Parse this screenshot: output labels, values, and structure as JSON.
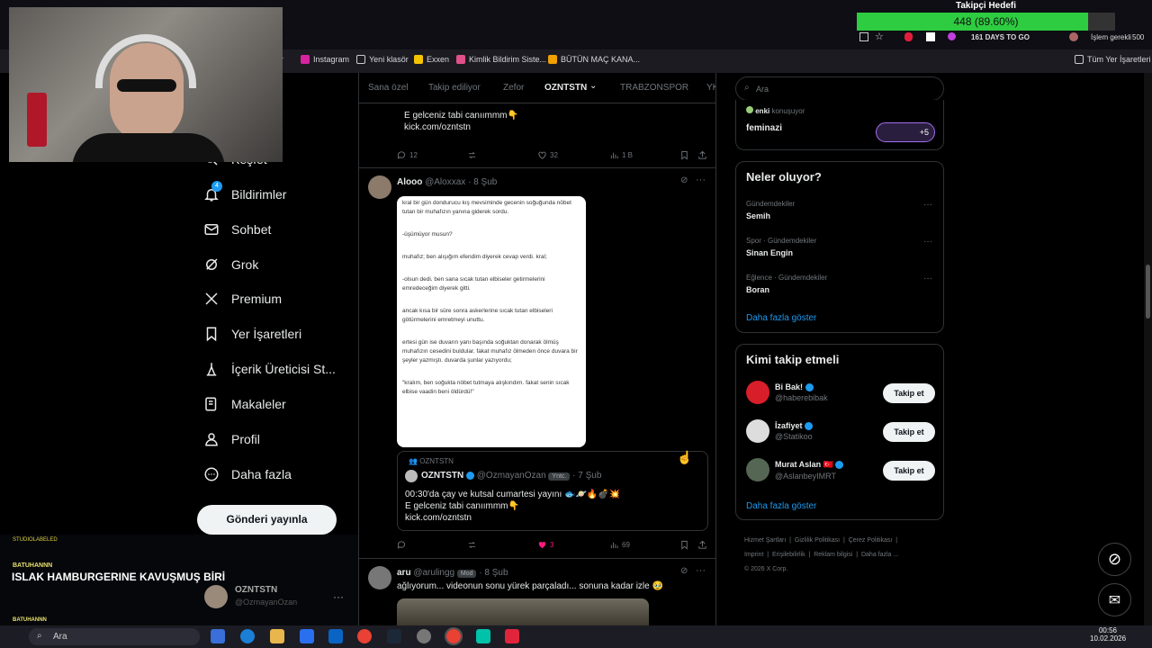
{
  "browser": {
    "bookmarks": [
      "r",
      "Instagram",
      "Yeni klasör",
      "Exxen",
      "Kimlik Bildirim Siste...",
      "BÜTÜN MAÇ KANA..."
    ],
    "all_bookmarks": "Tüm Yer İşaretleri",
    "toolbar_text": "161 DAYS TO GO",
    "toolbar_text2": "İşlem gerekli",
    "toolbar_num": "500"
  },
  "overlay": {
    "follower_goal_title": "Takipçi Hedefi",
    "follower_goal_value": "448 (89.60%)",
    "follower_goal_fraction": 0.896,
    "chat_username_small": "BATUHANNN",
    "chat_message": "ISLAK HAMBURGERINE KAVUŞMUŞ BİRİ",
    "chat_username_small2": "BATUHANNN",
    "streamer_name": "OZNTSTN",
    "streamer_handle": "@OzmayanOzan",
    "faint_label": "STUDIOLABELED"
  },
  "nav": {
    "items": [
      {
        "label": "Keşfet",
        "icon": "search-icon"
      },
      {
        "label": "Bildirimler",
        "icon": "bell-icon",
        "badge": "4"
      },
      {
        "label": "Sohbet",
        "icon": "mail-icon"
      },
      {
        "label": "Grok",
        "icon": "grok-icon"
      },
      {
        "label": "Premium",
        "icon": "x-logo-icon"
      },
      {
        "label": "Yer İşaretleri",
        "icon": "bookmark-icon"
      },
      {
        "label": "İçerik Üreticisi St...",
        "icon": "creator-studio-icon"
      },
      {
        "label": "Makaleler",
        "icon": "article-icon"
      },
      {
        "label": "Profil",
        "icon": "profile-icon"
      },
      {
        "label": "Daha fazla",
        "icon": "more-circle-icon"
      }
    ],
    "post_button": "Gönderi yayınla"
  },
  "feed": {
    "tabs": [
      "Sana özel",
      "Takip ediliyor",
      "Zefor",
      "OZNTSTN",
      "TRABZONSPOR",
      "YK"
    ],
    "active_tab": "OZNTSTN",
    "top_tweet": {
      "line1": "E gelceniz tabi canıımmm👇",
      "line2": "kick.com/ozntstn",
      "replies": "12",
      "likes": "32",
      "views": "1 B"
    },
    "tweet2": {
      "name": "Alooo",
      "handle": "@Aloxxax",
      "date": "8 Şub",
      "image_text": [
        "kral bir gün dondurucu kış mevsiminde gecenin soğuğunda nöbet tutan bir muhafızın yanına giderek sordu.",
        "-üşümüyor musun?",
        "muhafız; ben alışığım efendim diyerek cevap verdi. kral;",
        "-olsun dedi. ben sana sıcak tutan elbiseler getirmelerini emredeceğim diyerek gitti.",
        "ancak kısa bir süre sonra askerlerine sıcak tutan elbiseleri götürmelerini emretmeyi unuttu.",
        "ertesi gün ise duvarın yanı başında soğuktan donarak ölmüş muhafızın cesedini buldular. fakat muhafız ölmeden önce duvara bir şeyler yazmıştı. duvarda şunlar yazıyordu;",
        "\"kralım, ben soğukta nöbet tutmaya alışkındım. fakat senin sıcak elbise vaadin beni öldürdü!\""
      ],
      "quote_community": "OZNTSTN",
      "quote_name": "OZNTSTN",
      "quote_handle": "@OzmayanOzan",
      "quote_badge": "Yntc.",
      "quote_date": "7 Şub",
      "quote_line1": "00:30'da çay ve kutsal cumartesi yayını 🐟🪐🔥💣💥",
      "quote_line2": "E gelceniz tabi canıımmm👇",
      "quote_line3": "kick.com/ozntstn",
      "likes": "3",
      "views": "69"
    },
    "tweet3": {
      "name": "aru",
      "handle": "@arulingg",
      "badge": "Mod",
      "date": "8 Şub",
      "text": "ağlıyorum... videonun sonu yürek parçaladı... sonuna kadar izle 🥹"
    }
  },
  "right": {
    "search_placeholder": "Ara",
    "space_host": "enki",
    "space_host_suffix": "konuşuyor",
    "space_title": "feminazi",
    "space_more": "+5",
    "trends_title": "Neler oluyor?",
    "trends": [
      {
        "context": "Gündemdekiler",
        "name": "Semih"
      },
      {
        "context": "Spor · Gündemdekiler",
        "name": "Sinan Engin"
      },
      {
        "context": "Eğlence · Gündemdekiler",
        "name": "Boran"
      }
    ],
    "show_more": "Daha fazla göster",
    "wtf_title": "Kimi takip etmeli",
    "wtf": [
      {
        "name": "Bi Bak!",
        "handle": "@haberebibak",
        "avatar_color": "#d81e28"
      },
      {
        "name": "İzafiyet",
        "handle": "@Statikoo",
        "avatar_color": "#dddddd"
      },
      {
        "name": "Murat Aslan 🇹🇷",
        "handle": "@AslanbeyIMRT",
        "avatar_color": "#556655"
      }
    ],
    "follow_label": "Takip et",
    "footer": [
      "Hizmet Şartları",
      "Gizlilik Politikası",
      "Çerez Politikası",
      "Imprint",
      "Erişilebilirlik",
      "Reklam bilgisi",
      "Daha fazla ..."
    ],
    "copyright": "© 2026 X Corp."
  },
  "taskbar": {
    "search": "Ara",
    "time": "00:56",
    "date": "10.02.2026"
  },
  "colors": {
    "accent": "#1d9bf0",
    "like": "#f91880",
    "goal_bar": "#2ecc40"
  }
}
